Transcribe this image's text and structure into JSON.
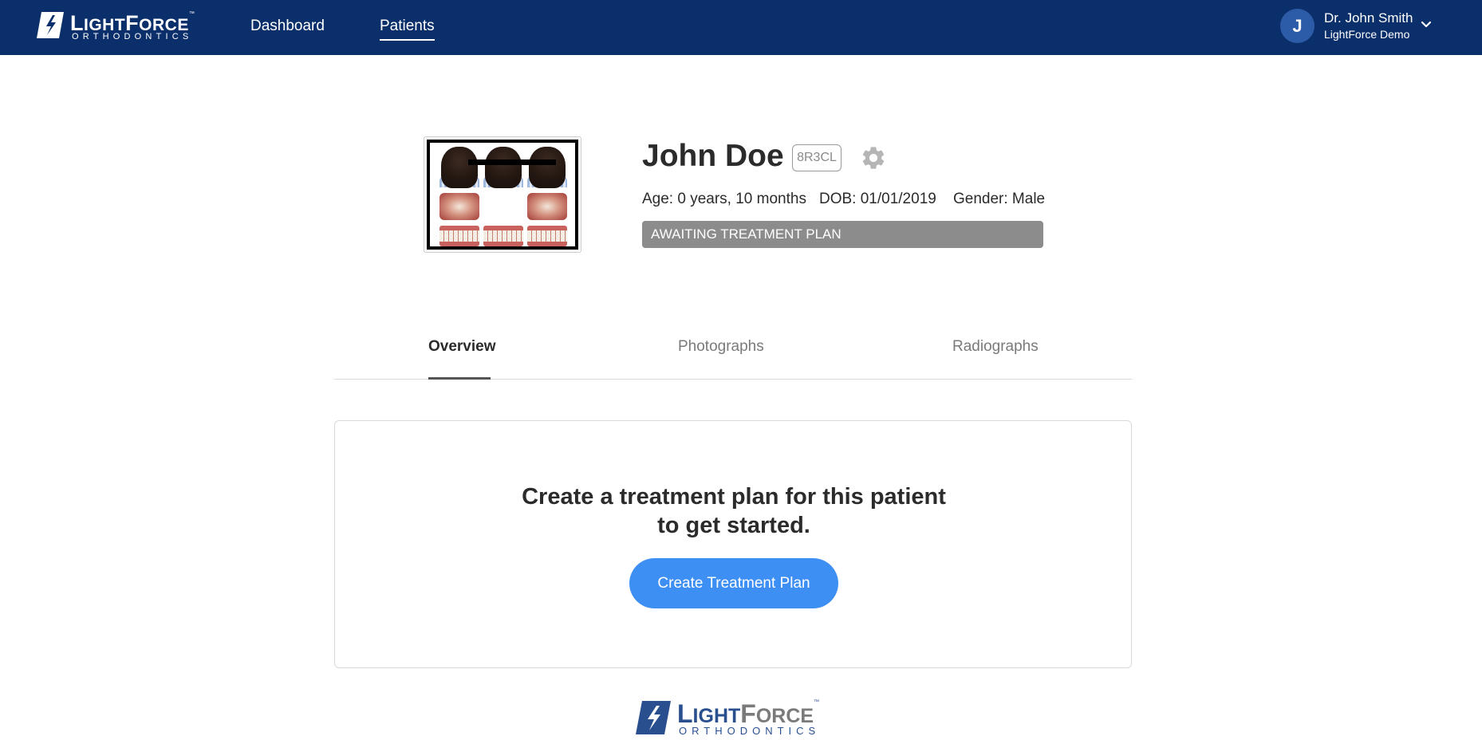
{
  "brand": {
    "logo_main_initial": "L",
    "logo_main_rest": "IGHT",
    "logo_force_initial": "F",
    "logo_force_rest": "ORCE",
    "logo_tm": "™",
    "logo_sub": "ORTHODONTICS",
    "primary_color": "#0b2f6b",
    "accent_color": "#3e8ff4"
  },
  "nav": {
    "items": [
      {
        "label": "Dashboard",
        "active": false
      },
      {
        "label": "Patients",
        "active": true
      }
    ]
  },
  "user": {
    "initial": "J",
    "name": "Dr. John Smith",
    "organization": "LightForce Demo",
    "menu_icon": "chevron-down-icon"
  },
  "patient": {
    "name": "John Doe",
    "code": "8R3CL",
    "settings_icon": "gear-icon",
    "age": "Age: 0 years, 10 months",
    "dob": "DOB: 01/01/2019",
    "gender": "Gender: Male",
    "status": "AWAITING TREATMENT PLAN",
    "status_color": "#8c8c8c"
  },
  "tabs": [
    {
      "label": "Overview",
      "active": true
    },
    {
      "label": "Photographs",
      "active": false
    },
    {
      "label": "Radiographs",
      "active": false
    }
  ],
  "empty_state": {
    "title_line1": "Create a treatment plan for this patient",
    "title_line2": "to get started.",
    "button_label": "Create Treatment Plan"
  }
}
